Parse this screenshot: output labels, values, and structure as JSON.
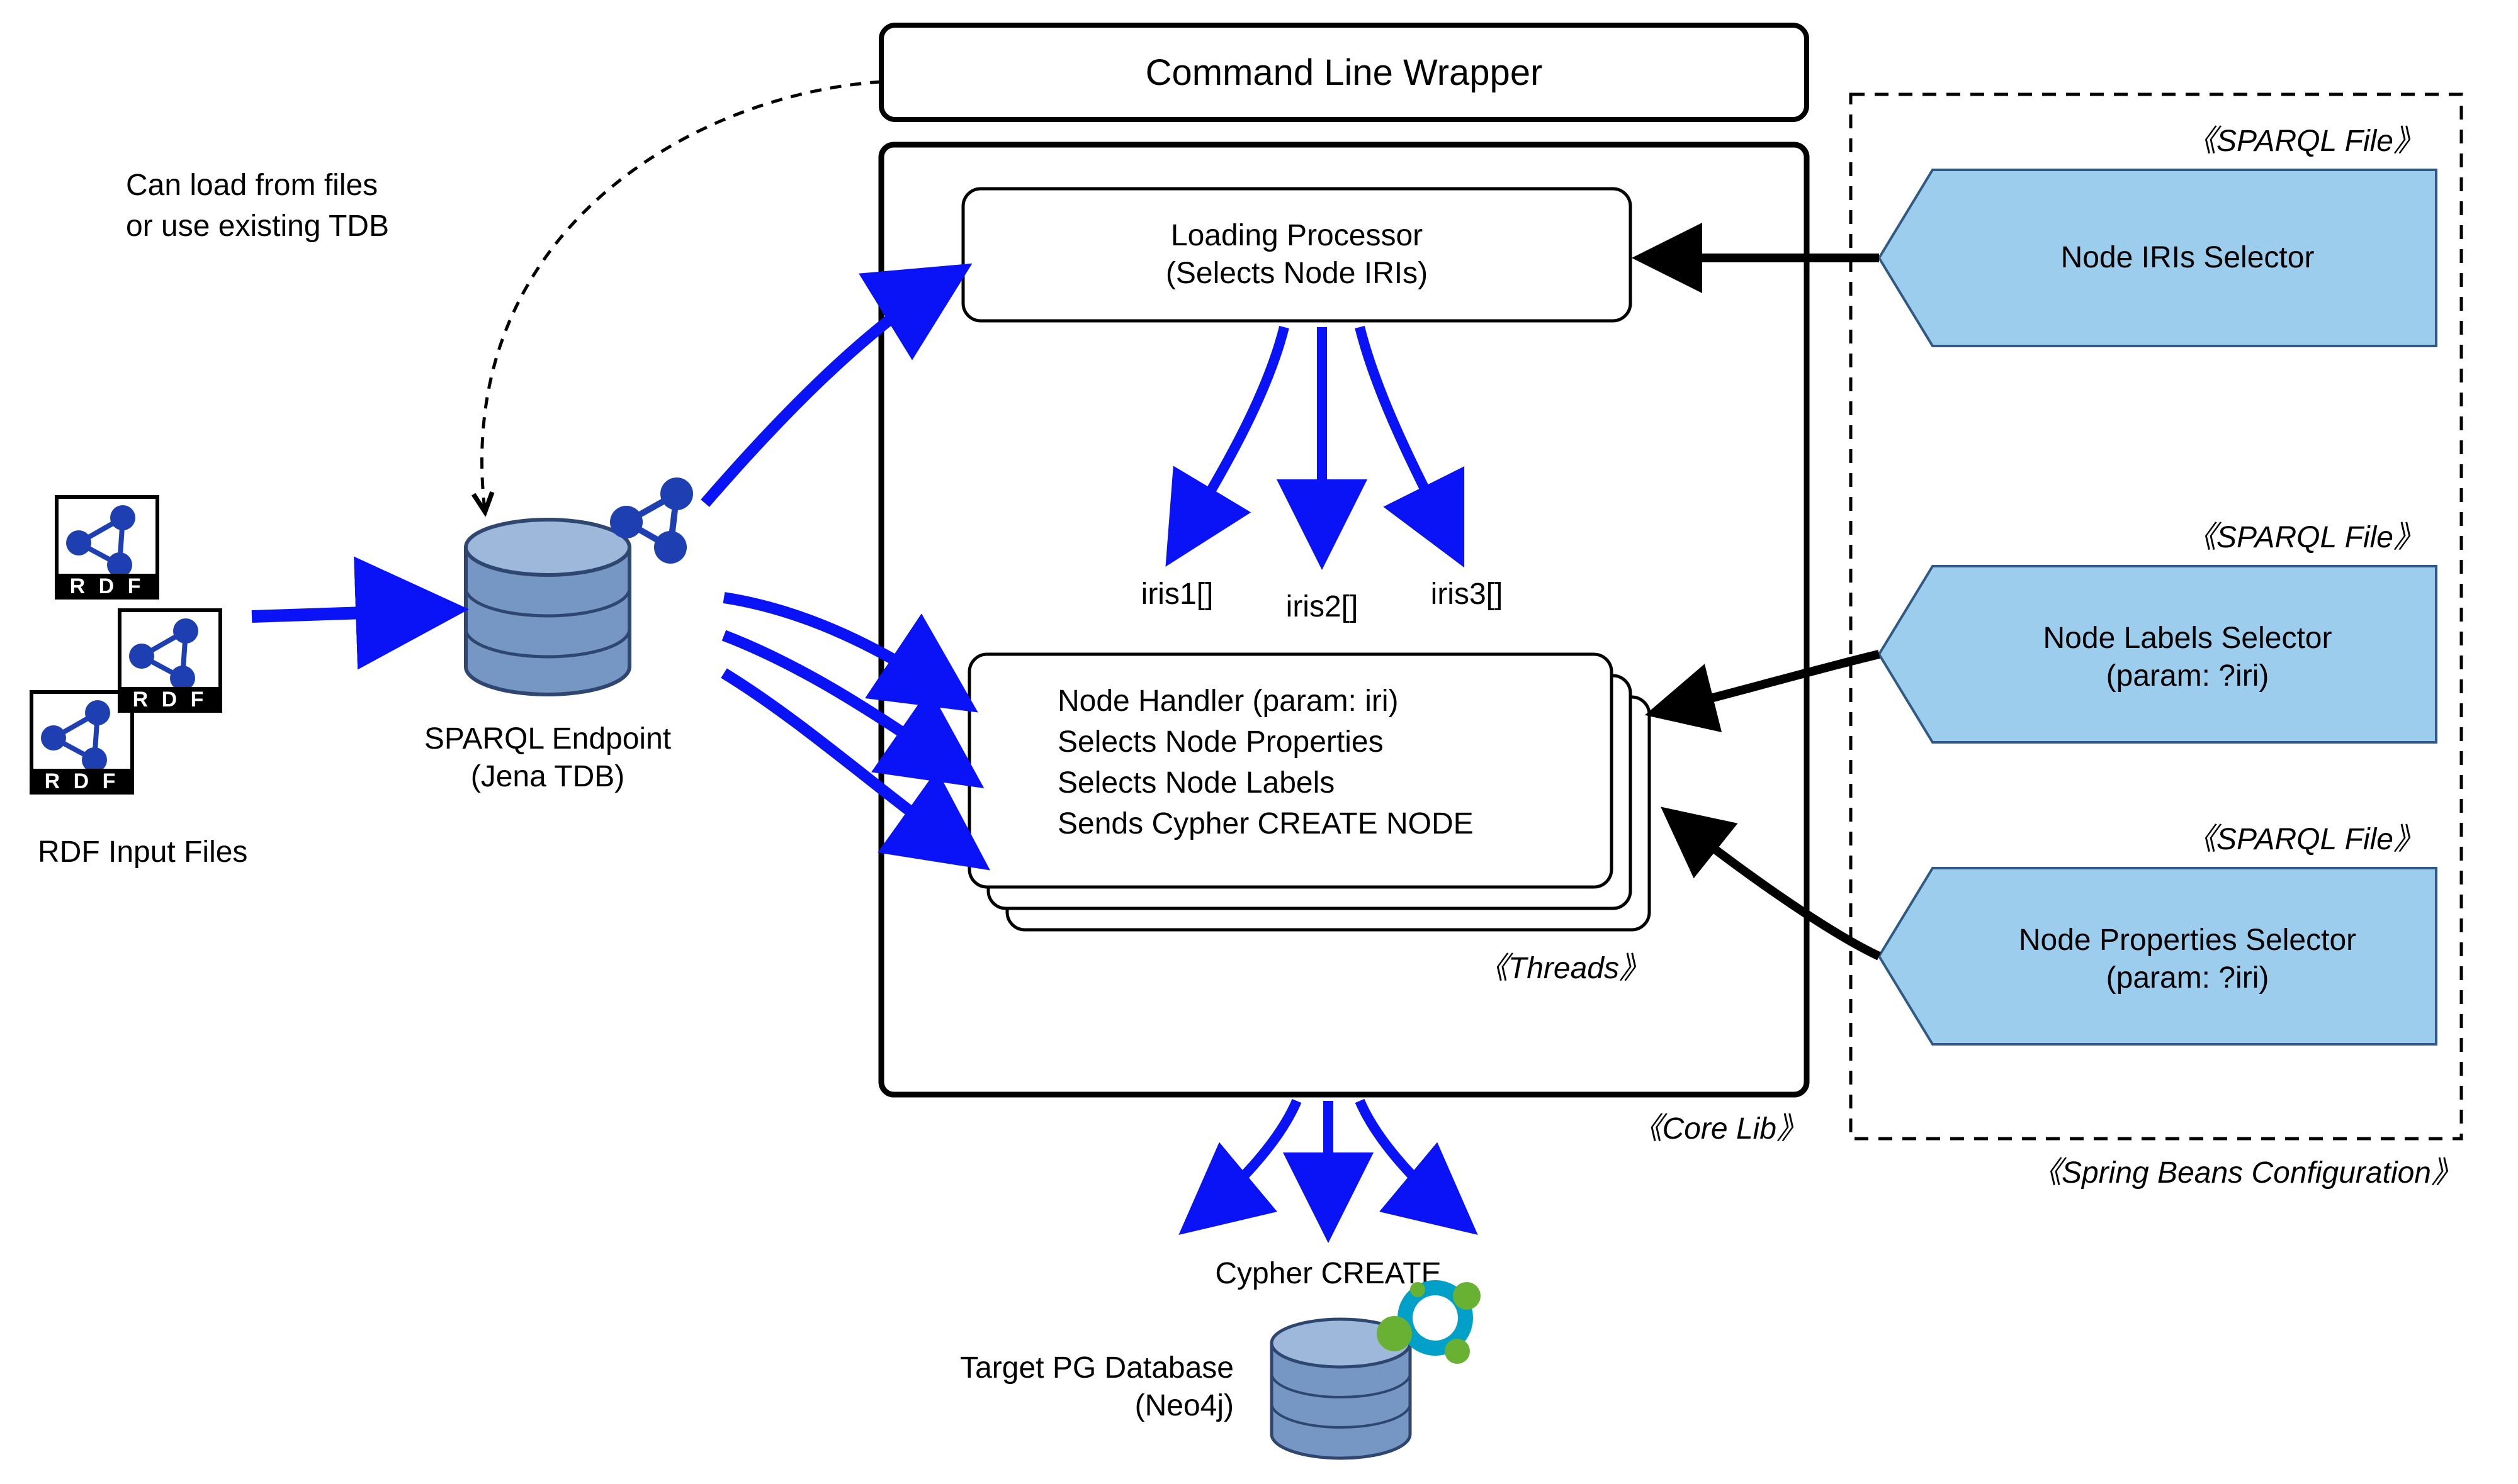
{
  "header": {
    "title": "Command Line Wrapper"
  },
  "annotations": {
    "load_note_l1": "Can load from files",
    "load_note_l2": "or use existing TDB"
  },
  "rdf": {
    "badge": "R D F",
    "input_label": "RDF Input Files"
  },
  "sparql": {
    "label_l1": "SPARQL Endpoint",
    "label_l2": "(Jena TDB)"
  },
  "core": {
    "stereotype": "《Core Lib》",
    "loading_processor_l1": "Loading Processor",
    "loading_processor_l2": "(Selects Node IRIs)",
    "iris1": "iris1[]",
    "iris2": "iris2[]",
    "iris3": "iris3[]",
    "node_handler_l1": "Node Handler (param: iri)",
    "node_handler_l2": "Selects Node Properties",
    "node_handler_l3": "Selects Node Labels",
    "node_handler_l4": "Sends Cypher CREATE NODE",
    "threads": "《Threads》"
  },
  "cypher": {
    "label": "Cypher CREATE"
  },
  "target": {
    "label_l1": "Target PG Database",
    "label_l2": "(Neo4j)"
  },
  "spring": {
    "stereotype": "《Spring Beans Configuration》",
    "file_stereo": "《SPARQL File》",
    "file1": "Node IRIs Selector",
    "file2_l1": "Node Labels Selector",
    "file2_l2": "(param: ?iri)",
    "file3_l1": "Node Properties Selector",
    "file3_l2": "(param: ?iri)"
  },
  "colors": {
    "blue_arrow": "#0a13f6",
    "file_fill": "#9dcdec",
    "file_stroke": "#2f5a84",
    "db_fill": "#7697c3",
    "db_stroke": "#2f4770",
    "rdf_icon": "#1d3fb1",
    "neo_green": "#68b132",
    "neo_blue": "#00a0c8"
  }
}
